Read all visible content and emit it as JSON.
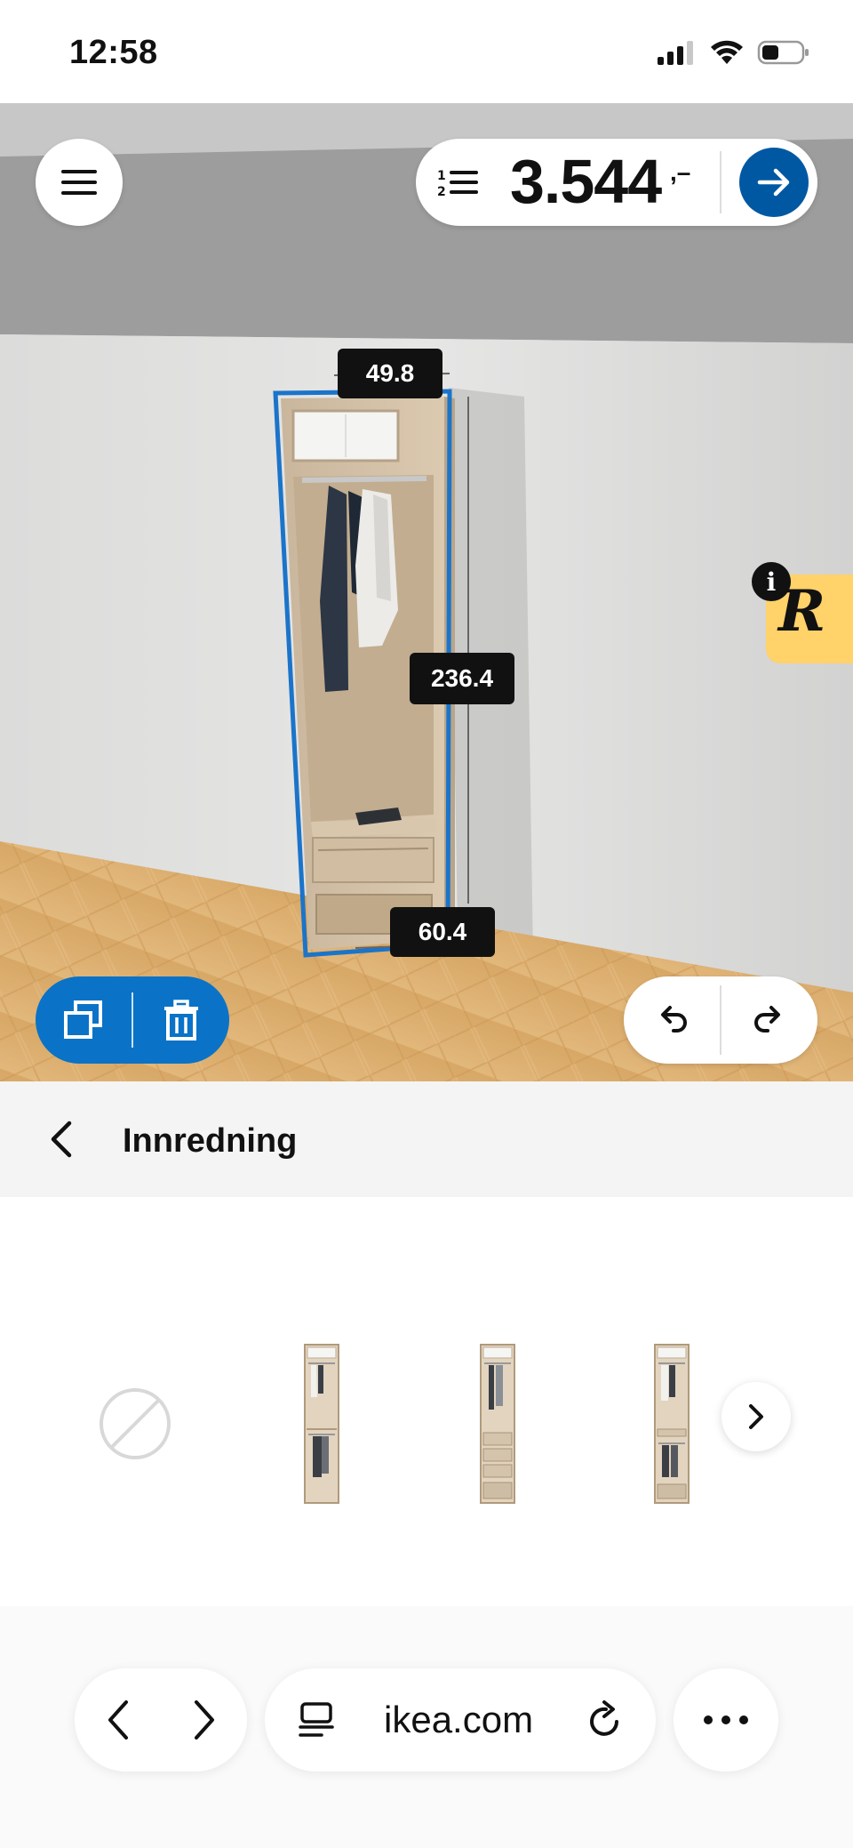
{
  "status_bar": {
    "time": "12:58"
  },
  "scene": {
    "price": "3.544",
    "price_suffix": ",–",
    "dimensions": {
      "width": "49.8",
      "height": "236.4",
      "depth": "60.4"
    },
    "badge_letter": "R",
    "info_label": "i",
    "colors": {
      "accent": "#0058a3",
      "edit_pill": "#0a73c7",
      "badge": "#ffd26a"
    }
  },
  "section": {
    "title": "Innredning"
  },
  "browser": {
    "url": "ikea.com"
  },
  "icons": {
    "menu": "hamburger-icon",
    "list": "numbered-list-icon",
    "checkout": "arrow-right-icon",
    "duplicate": "duplicate-icon",
    "delete": "trash-icon",
    "undo": "undo-icon",
    "redo": "redo-icon",
    "back": "chevron-left-icon",
    "none_option": "prohibited-icon",
    "next": "chevron-right-icon",
    "reader": "reader-icon",
    "reload": "reload-icon",
    "more": "more-icon"
  }
}
